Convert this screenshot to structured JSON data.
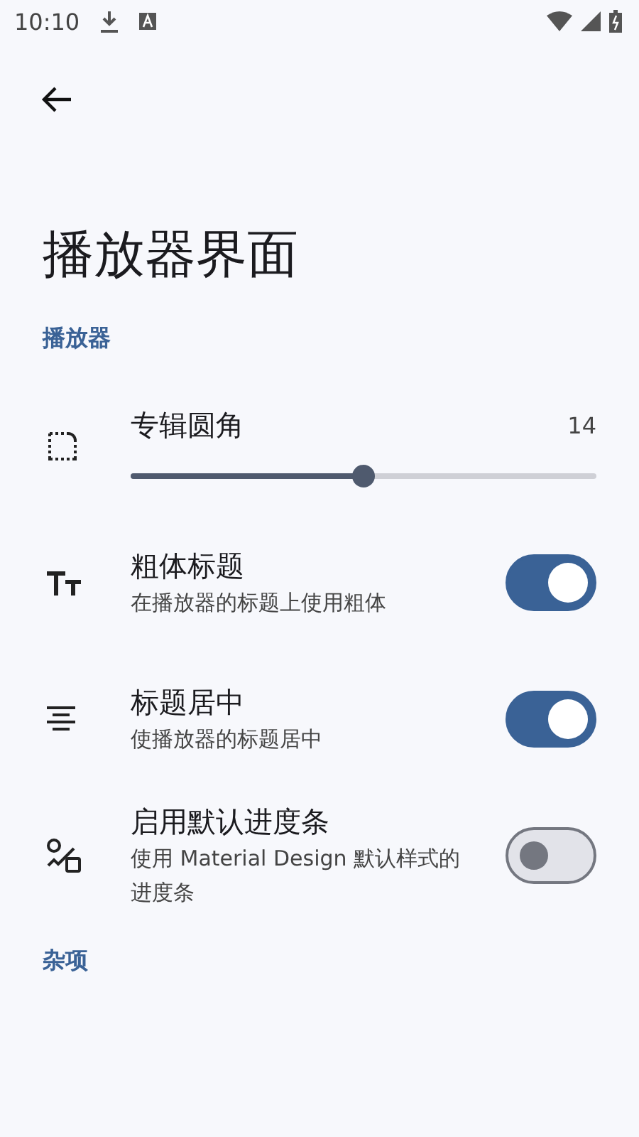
{
  "status_bar": {
    "time": "10:10"
  },
  "title": "播放器界面",
  "sections": [
    {
      "header": "播放器",
      "items": [
        {
          "kind": "slider",
          "title": "专辑圆角",
          "value": "14",
          "level": 0.5
        },
        {
          "kind": "switch",
          "title": "粗体标题",
          "subtitle": "在播放器的标题上使用粗体",
          "on": true
        },
        {
          "kind": "switch",
          "title": "标题居中",
          "subtitle": "使播放器的标题居中",
          "on": true
        },
        {
          "kind": "switch",
          "title": "启用默认进度条",
          "subtitle": "使用 Material Design 默认样式的进度条",
          "on": false
        }
      ]
    },
    {
      "header": "杂项"
    }
  ]
}
